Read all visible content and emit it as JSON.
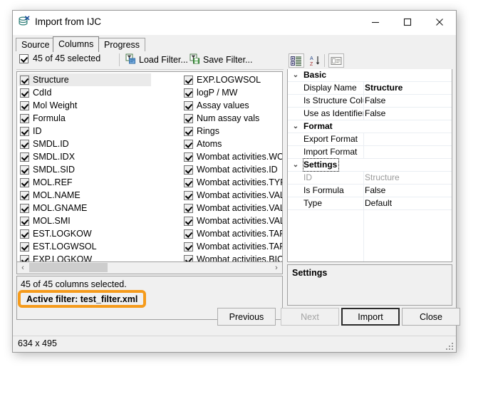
{
  "window": {
    "title": "Import from IJC",
    "icon": "database-import-icon",
    "minimize_label": "—",
    "maximize_label": "□",
    "close_label": "✕",
    "statusbar_text": "634 x 495"
  },
  "tabs": [
    {
      "label": "Source",
      "active": false
    },
    {
      "label": "Columns",
      "active": true
    },
    {
      "label": "Progress",
      "active": false
    }
  ],
  "toolbar": {
    "select_all_checked": true,
    "selected_label": "45 of 45 selected",
    "load_filter_label": "Load Filter...",
    "save_filter_label": "Save Filter...",
    "load_filter_icon": "filter-open-icon",
    "save_filter_icon": "filter-save-icon"
  },
  "columns_list": {
    "left": [
      {
        "label": "Structure",
        "checked": true,
        "selected": true
      },
      {
        "label": "CdId",
        "checked": true,
        "selected": false
      },
      {
        "label": "Mol Weight",
        "checked": true,
        "selected": false
      },
      {
        "label": "Formula",
        "checked": true,
        "selected": false
      },
      {
        "label": "ID",
        "checked": true,
        "selected": false
      },
      {
        "label": "SMDL.ID",
        "checked": true,
        "selected": false
      },
      {
        "label": "SMDL.IDX",
        "checked": true,
        "selected": false
      },
      {
        "label": "SMDL.SID",
        "checked": true,
        "selected": false
      },
      {
        "label": "MOL.REF",
        "checked": true,
        "selected": false
      },
      {
        "label": "MOL.NAME",
        "checked": true,
        "selected": false
      },
      {
        "label": "MOL.GNAME",
        "checked": true,
        "selected": false
      },
      {
        "label": "MOL.SMI",
        "checked": true,
        "selected": false
      },
      {
        "label": "EST.LOGKOW",
        "checked": true,
        "selected": false
      },
      {
        "label": "EST.LOGWSOL",
        "checked": true,
        "selected": false
      },
      {
        "label": "EXP.LOGKOW",
        "checked": true,
        "selected": false
      }
    ],
    "right": [
      {
        "label": "EXP.LOGWSOL",
        "checked": true,
        "selected": false
      },
      {
        "label": "logP / MW",
        "checked": true,
        "selected": false
      },
      {
        "label": "Assay values",
        "checked": true,
        "selected": false
      },
      {
        "label": "Num assay vals",
        "checked": true,
        "selected": false
      },
      {
        "label": "Rings",
        "checked": true,
        "selected": false
      },
      {
        "label": "Atoms",
        "checked": true,
        "selected": false
      },
      {
        "label": "Wombat activities.WOM",
        "checked": true,
        "selected": false
      },
      {
        "label": "Wombat activities.ID",
        "checked": true,
        "selected": false
      },
      {
        "label": "Wombat activities.TYPE",
        "checked": true,
        "selected": false
      },
      {
        "label": "Wombat activities.VALUE",
        "checked": true,
        "selected": false
      },
      {
        "label": "Wombat activities.VALUE",
        "checked": true,
        "selected": false
      },
      {
        "label": "Wombat activities.VALUE",
        "checked": true,
        "selected": false
      },
      {
        "label": "Wombat activities.TARG",
        "checked": true,
        "selected": false
      },
      {
        "label": "Wombat activities.TARG",
        "checked": true,
        "selected": false
      },
      {
        "label": "Wombat activities.BIO.S",
        "checked": true,
        "selected": false
      }
    ]
  },
  "hscrollbar": {
    "left_arrow": "‹",
    "right_arrow": "›"
  },
  "status": {
    "columns_line": "45 of 45 columns selected.",
    "active_filter_line": "Active filter: test_filter.xml",
    "highlight_color": "#f59b1c"
  },
  "properties_toolbar": {
    "categorized_icon": "categorized-view-icon",
    "alphabetic_icon": "sort-alphabetic-icon",
    "pages_icon": "property-pages-icon"
  },
  "properties": [
    {
      "kind": "category",
      "chevron": "⌄",
      "name": "Basic",
      "value": "",
      "focused": false
    },
    {
      "kind": "row",
      "name": "Display Name",
      "value": "Structure",
      "bold_value": true,
      "dim": false
    },
    {
      "kind": "row",
      "name": "Is Structure Colu",
      "value": "False",
      "bold_value": false,
      "dim": false
    },
    {
      "kind": "row",
      "name": "Use as Identifier",
      "value": "False",
      "bold_value": false,
      "dim": false
    },
    {
      "kind": "category",
      "chevron": "⌄",
      "name": "Format",
      "value": "",
      "focused": false
    },
    {
      "kind": "row",
      "name": "Export Format",
      "value": "",
      "bold_value": false,
      "dim": false
    },
    {
      "kind": "row",
      "name": "Import Format",
      "value": "",
      "bold_value": false,
      "dim": false
    },
    {
      "kind": "category",
      "chevron": "⌄",
      "name": "Settings",
      "value": "",
      "focused": true
    },
    {
      "kind": "row",
      "name": "ID",
      "value": "Structure",
      "bold_value": false,
      "dim": true
    },
    {
      "kind": "row",
      "name": "Is Formula",
      "value": "False",
      "bold_value": false,
      "dim": false
    },
    {
      "kind": "row",
      "name": "Type",
      "value": "Default",
      "bold_value": false,
      "dim": false
    }
  ],
  "settings_panel": {
    "title": "Settings"
  },
  "dialog_buttons": [
    {
      "label": "Previous",
      "state": "normal"
    },
    {
      "label": "Next",
      "state": "disabled"
    },
    {
      "label": "Import",
      "state": "default"
    },
    {
      "label": "Close",
      "state": "normal"
    }
  ]
}
